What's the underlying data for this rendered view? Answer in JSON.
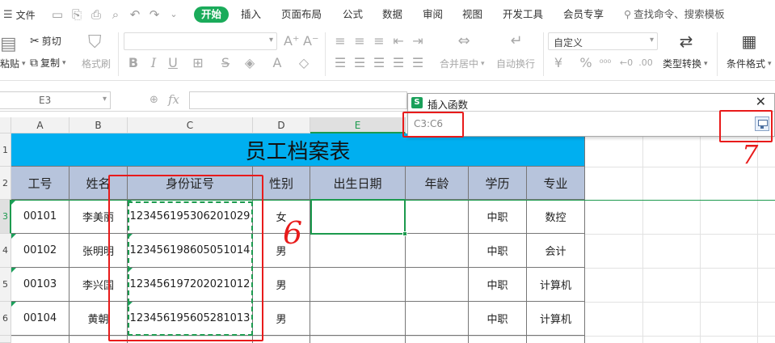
{
  "menu": {
    "file": "文件",
    "tabs": [
      "开始",
      "插入",
      "页面布局",
      "公式",
      "数据",
      "审阅",
      "视图",
      "开发工具",
      "会员专享"
    ],
    "active_tab": "开始",
    "search": "查找命令、搜索模板"
  },
  "ribbon": {
    "paste": "粘贴",
    "cut": "剪切",
    "copy": "复制",
    "format_painter": "格式刷",
    "merge_center": "合并居中",
    "auto_wrap": "自动换行",
    "number_format": "自定义",
    "type_convert": "类型转换",
    "cond_format": "条件格式"
  },
  "formula_bar": {
    "name_box": "E3",
    "fx": "fx"
  },
  "columns": [
    "A",
    "B",
    "C",
    "D",
    "E"
  ],
  "rows": [
    "1",
    "2",
    "3",
    "4",
    "5",
    "6"
  ],
  "sheet": {
    "title": "员工档案表",
    "headers": [
      "工号",
      "姓名",
      "身份证号",
      "性别",
      "出生日期",
      "年龄",
      "学历",
      "专业"
    ],
    "data": [
      [
        "00101",
        "李美丽",
        "123456195306201029",
        "女",
        "",
        "",
        "中职",
        "数控"
      ],
      [
        "00102",
        "张明明",
        "123456198605051014",
        "男",
        "",
        "",
        "中职",
        "会计"
      ],
      [
        "00103",
        "李兴国",
        "123456197202021012",
        "男",
        "",
        "",
        "中职",
        "计算机"
      ],
      [
        "00104",
        "黄朝",
        "123456195605281013",
        "男",
        "",
        "",
        "中职",
        "计算机"
      ]
    ]
  },
  "dialog": {
    "title": "插入函数",
    "logo": "S",
    "input_value": "C3:C6",
    "close": "✕"
  },
  "annotations": {
    "six": "6",
    "seven": "7"
  },
  "colors": {
    "accent_green": "#1aab5a",
    "title_fill": "#00aff0",
    "header_fill": "#b7c4dc",
    "annotation_red": "#e81b1b"
  }
}
